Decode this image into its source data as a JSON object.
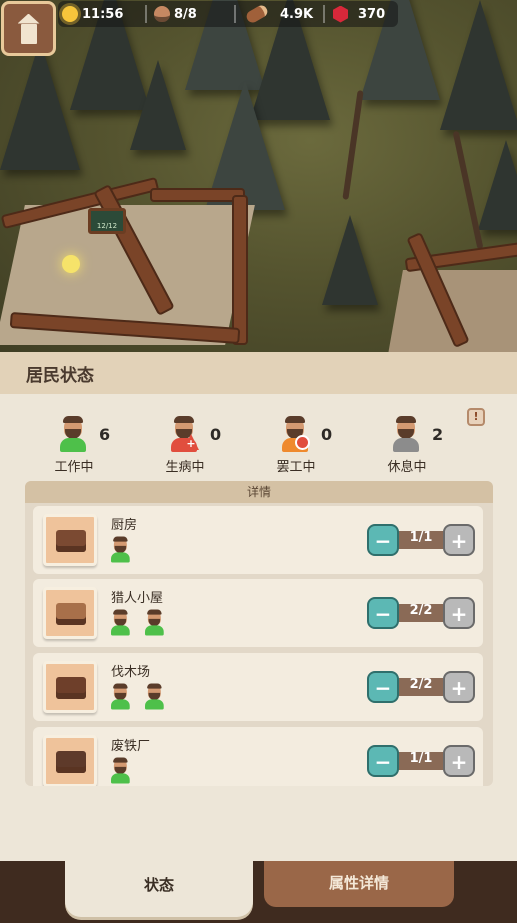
{
  "topbar": {
    "time": "11:56",
    "population": "8/8",
    "wood": "4.9K",
    "gems": "370"
  },
  "scene": {
    "hut_sign": "12/12"
  },
  "panel": {
    "title": "居民状态",
    "summary": [
      {
        "label": "工作中",
        "count": "6",
        "status": "working"
      },
      {
        "label": "生病中",
        "count": "0",
        "status": "sick"
      },
      {
        "label": "罢工中",
        "count": "0",
        "status": "strike"
      },
      {
        "label": "休息中",
        "count": "2",
        "status": "resting"
      }
    ],
    "warn_badge": "!",
    "details_header": "详情",
    "buildings": [
      {
        "name": "厨房",
        "assigned": "1/1",
        "workers": 1
      },
      {
        "name": "猎人小屋",
        "assigned": "2/2",
        "workers": 2
      },
      {
        "name": "伐木场",
        "assigned": "2/2",
        "workers": 2
      },
      {
        "name": "废铁厂",
        "assigned": "1/1",
        "workers": 1
      }
    ],
    "minus_label": "−",
    "plus_label": "+"
  },
  "tabs": {
    "status": "状态",
    "attributes": "属性详情"
  },
  "colors": {
    "working": "#4ec04a",
    "sick": "#e14e3e",
    "strike": "#ef8a2e",
    "resting": "#8c8c8c",
    "minus_button": "#5cb8b4",
    "plus_button": "#b9b9b9"
  }
}
